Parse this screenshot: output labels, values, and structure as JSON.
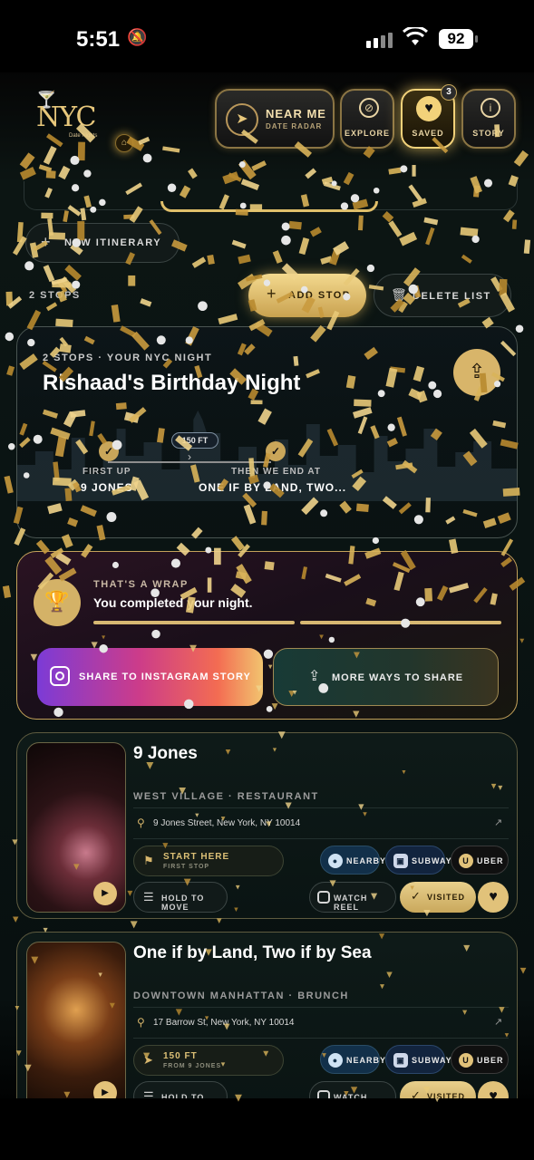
{
  "status_bar": {
    "time": "5:51",
    "battery": "92"
  },
  "header": {
    "logo_text": "NYC",
    "logo_subtitle": "Date Nights",
    "near_me": {
      "title": "NEAR ME",
      "subtitle": "DATE RADAR"
    },
    "nav": [
      {
        "label": "EXPLORE",
        "icon": "compass-icon"
      },
      {
        "label": "SAVED",
        "icon": "heart-icon",
        "badge": "3"
      },
      {
        "label": "STORY",
        "icon": "info-icon"
      }
    ]
  },
  "toolbar": {
    "new_itinerary": "NEW ITINERARY",
    "stops_count": "2 STOPS",
    "add_stop": "ADD STOP",
    "delete_list": "DELETE LIST"
  },
  "itinerary": {
    "kicker": "2 STOPS · YOUR NYC NIGHT",
    "title": "Rishaad's Birthday Night",
    "distance": "150 FT",
    "first_label": "FIRST UP",
    "first_value": "9 JONES",
    "end_label": "THEN WE END AT",
    "end_value": "ONE IF BY LAND, TWO..."
  },
  "wrap": {
    "kicker": "THAT'S A WRAP",
    "headline": "You completed your night.",
    "progress": [
      1.0,
      1.0
    ],
    "instagram_button": "SHARE TO INSTAGRAM STORY",
    "more_button": "MORE WAYS TO SHARE"
  },
  "venues": [
    {
      "name": "9 Jones",
      "category": "WEST VILLAGE · RESTAURANT",
      "address": "9 Jones Street, New York, NY 10014",
      "badge_title": "START HERE",
      "badge_sub": "FIRST STOP",
      "nearby": "NEARBY",
      "subway": "SUBWAY",
      "uber": "UBER",
      "hold": "HOLD TO MOVE",
      "reel": "WATCH REEL",
      "visited": "VISITED"
    },
    {
      "name": "One if by Land, Two if by Sea",
      "category": "DOWNTOWN MANHATTAN · BRUNCH",
      "address": "17 Barrow St, New York, NY 10014",
      "badge_title": "150 FT",
      "badge_sub": "FROM 9 JONES",
      "nearby": "NEARBY",
      "subway": "SUBWAY",
      "uber": "UBER",
      "hold": "HOLD TO MOVE",
      "reel": "WATCH REEL",
      "visited": "VISITED"
    }
  ],
  "colors": {
    "gold": "#e0bf6a",
    "background": "#0a1413"
  }
}
